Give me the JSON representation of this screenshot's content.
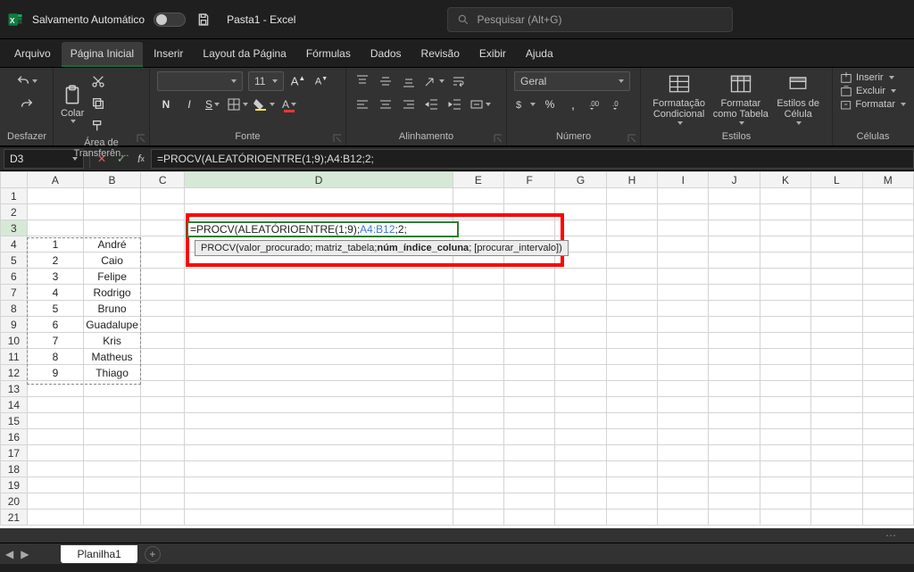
{
  "titlebar": {
    "autosave_label": "Salvamento Automático",
    "doc_title": "Pasta1 - Excel",
    "search_placeholder": "Pesquisar (Alt+G)"
  },
  "tabs": {
    "items": [
      "Arquivo",
      "Página Inicial",
      "Inserir",
      "Layout da Página",
      "Fórmulas",
      "Dados",
      "Revisão",
      "Exibir",
      "Ajuda"
    ],
    "active_index": 1
  },
  "ribbon": {
    "undo_group": "Desfazer",
    "clipboard_group": "Área de Transferên...",
    "paste_label": "Colar",
    "font_group": "Fonte",
    "font_size": "11",
    "alignment_group": "Alinhamento",
    "number_group": "Número",
    "number_format": "Geral",
    "styles_group": "Estilos",
    "cond_fmt": "Formatação Condicional",
    "fmt_table": "Formatar como Tabela",
    "cell_styles": "Estilos de Célula",
    "cells_group": "Células",
    "insert_label": "Inserir",
    "delete_label": "Excluir",
    "format_label": "Formatar"
  },
  "formula_bar": {
    "cell_ref": "D3",
    "formula": "=PROCV(ALEATÓRIOENTRE(1;9);A4:B12;2;"
  },
  "edit_cell": {
    "pre": "=PROCV(ALEATÓRIOENTRE(1;9);",
    "ref": "A4:B12",
    "post": ";2;"
  },
  "tooltip": {
    "t1": "PROCV(valor_procurado; matriz_tabela; ",
    "bold": "núm_índice_coluna",
    "t2": "; [procurar_intervalo])"
  },
  "columns": [
    "A",
    "B",
    "C",
    "D",
    "E",
    "F",
    "G",
    "H",
    "I",
    "J",
    "K",
    "L",
    "M"
  ],
  "data_rows": [
    {
      "n": "1",
      "name": "André"
    },
    {
      "n": "2",
      "name": "Caio"
    },
    {
      "n": "3",
      "name": "Felipe"
    },
    {
      "n": "4",
      "name": "Rodrigo"
    },
    {
      "n": "5",
      "name": "Bruno"
    },
    {
      "n": "6",
      "name": "Guadalupe"
    },
    {
      "n": "7",
      "name": "Kris"
    },
    {
      "n": "8",
      "name": "Matheus"
    },
    {
      "n": "9",
      "name": "Thiago"
    }
  ],
  "sheet_tab": "Planilha1"
}
